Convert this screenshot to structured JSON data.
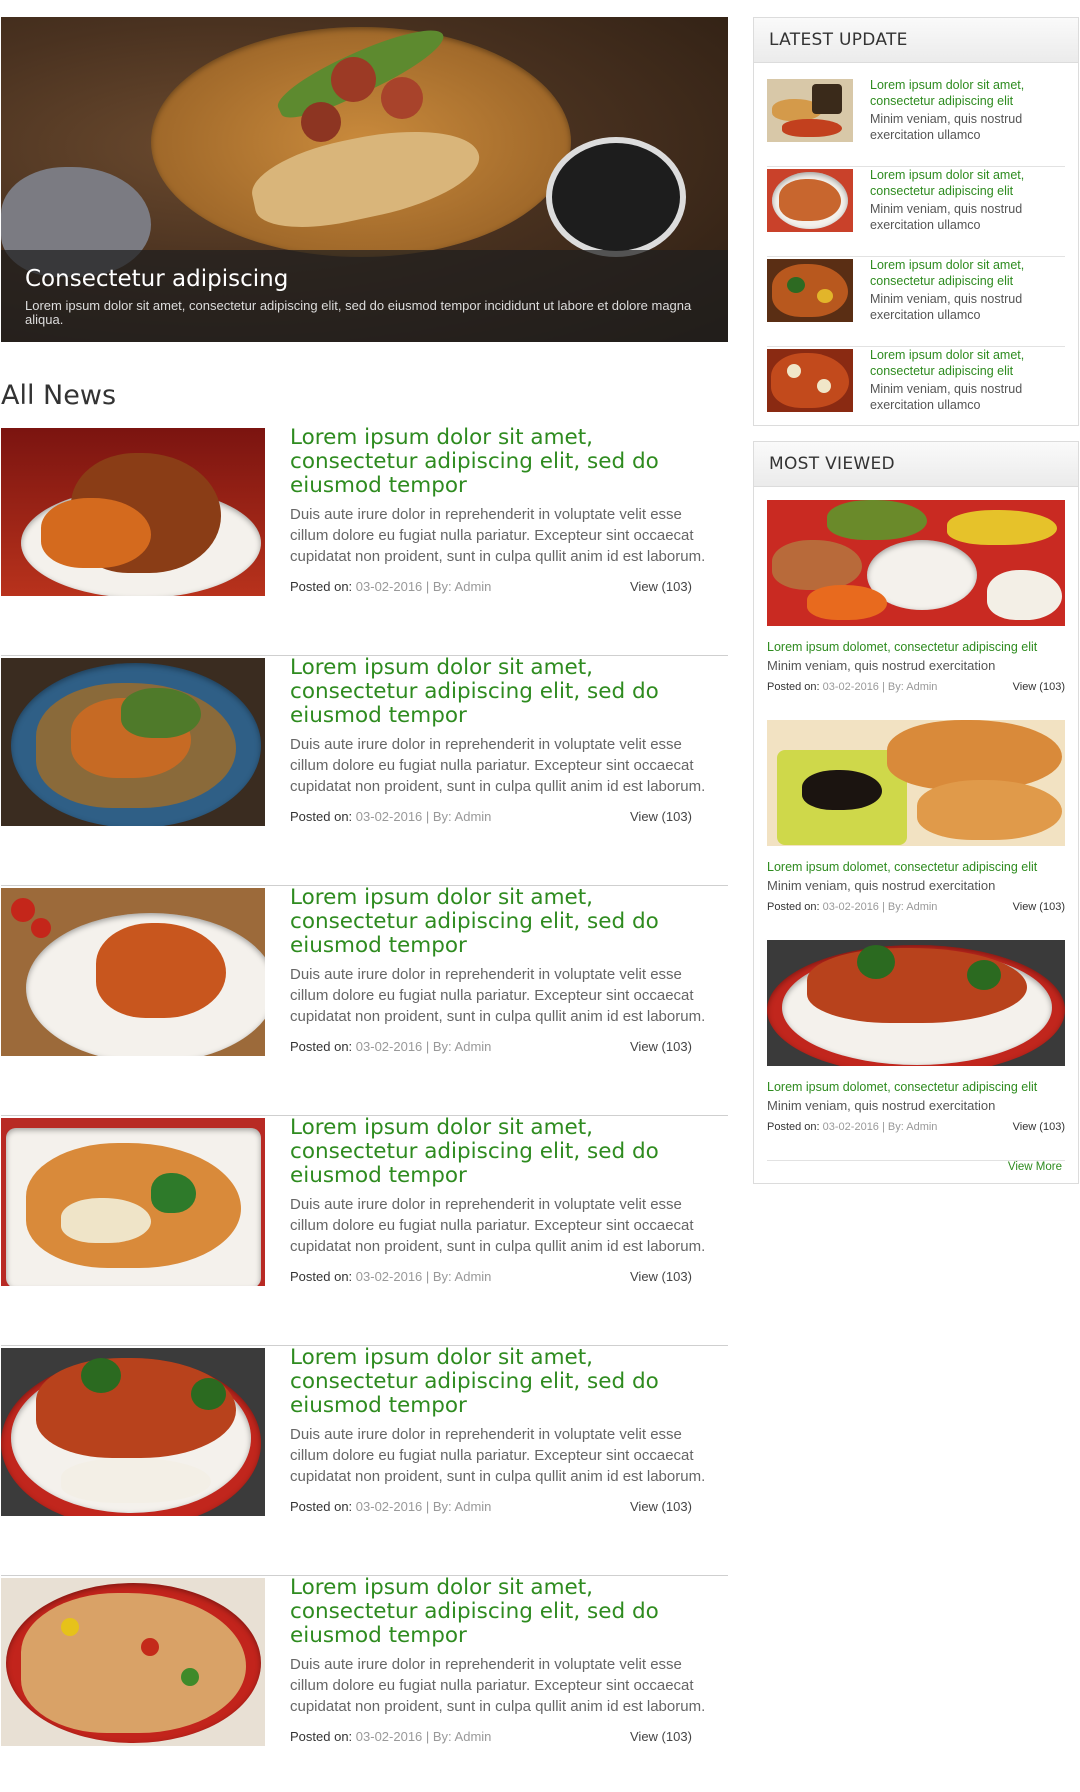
{
  "hero": {
    "title": "Consectetur adipiscing",
    "text": "Lorem ipsum dolor sit amet, consectetur adipiscing elit, sed do eiusmod tempor incididunt ut labore et dolore magna aliqua."
  },
  "news": {
    "heading": "All News",
    "posted_label": "Posted on:",
    "items": [
      {
        "title": "Lorem ipsum dolor sit amet, consectetur adipiscing elit, sed do eiusmod tempor",
        "text": "Duis aute irure dolor in reprehenderit in voluptate velit esse cillum dolore eu fugiat nulla pariatur. Excepteur sint occaecat cupidatat non proident, sunt in culpa qullit anim id est laborum.",
        "meta": "03-02-2016 | By: Admin",
        "views": "View (103)"
      },
      {
        "title": "Lorem ipsum dolor sit amet, consectetur adipiscing elit, sed do eiusmod tempor",
        "text": "Duis aute irure dolor in reprehenderit in voluptate velit esse cillum dolore eu fugiat nulla pariatur. Excepteur sint occaecat cupidatat non proident, sunt in culpa qullit anim id est laborum.",
        "meta": "03-02-2016 | By: Admin",
        "views": "View (103)"
      },
      {
        "title": "Lorem ipsum dolor sit amet, consectetur adipiscing elit, sed do eiusmod tempor",
        "text": "Duis aute irure dolor in reprehenderit in voluptate velit esse cillum dolore eu fugiat nulla pariatur. Excepteur sint occaecat cupidatat non proident, sunt in culpa qullit anim id est laborum.",
        "meta": "03-02-2016 | By: Admin",
        "views": "View (103)"
      },
      {
        "title": "Lorem ipsum dolor sit amet, consectetur adipiscing elit, sed do eiusmod tempor",
        "text": "Duis aute irure dolor in reprehenderit in voluptate velit esse cillum dolore eu fugiat nulla pariatur. Excepteur sint occaecat cupidatat non proident, sunt in culpa qullit anim id est laborum.",
        "meta": "03-02-2016 | By: Admin",
        "views": "View (103)"
      },
      {
        "title": "Lorem ipsum dolor sit amet, consectetur adipiscing elit, sed do eiusmod tempor",
        "text": "Duis aute irure dolor in reprehenderit in voluptate velit esse cillum dolore eu fugiat nulla pariatur. Excepteur sint occaecat cupidatat non proident, sunt in culpa qullit anim id est laborum.",
        "meta": "03-02-2016 | By: Admin",
        "views": "View (103)"
      },
      {
        "title": "Lorem ipsum dolor sit amet, consectetur adipiscing elit, sed do eiusmod tempor",
        "text": "Duis aute irure dolor in reprehenderit in voluptate velit esse cillum dolore eu fugiat nulla pariatur. Excepteur sint occaecat cupidatat non proident, sunt in culpa qullit anim id est laborum.",
        "meta": "03-02-2016 | By: Admin",
        "views": "View (103)"
      }
    ]
  },
  "latest": {
    "heading": "LATEST UPDATE",
    "items": [
      {
        "title": "Lorem ipsum dolor sit amet, consectetur adipiscing elit",
        "text": "Minim veniam, quis nostrud exercitation ullamco"
      },
      {
        "title": "Lorem ipsum dolor sit amet, consectetur adipiscing elit",
        "text": "Minim veniam, quis nostrud exercitation ullamco"
      },
      {
        "title": "Lorem ipsum dolor sit amet, consectetur adipiscing elit",
        "text": "Minim veniam, quis nostrud exercitation ullamco"
      },
      {
        "title": "Lorem ipsum dolor sit amet, consectetur adipiscing elit",
        "text": "Minim veniam, quis nostrud exercitation ullamco"
      }
    ]
  },
  "viewed": {
    "heading": "MOST VIEWED",
    "posted_label": "Posted on:",
    "more": "View More",
    "items": [
      {
        "title": "Lorem ipsum dolomet, consectetur adipiscing elit",
        "text": "Minim veniam, quis nostrud exercitation",
        "meta": "03-02-2016 | By: Admin",
        "views": "View (103)"
      },
      {
        "title": "Lorem ipsum dolomet, consectetur adipiscing elit",
        "text": "Minim veniam, quis nostrud exercitation",
        "meta": "03-02-2016 | By: Admin",
        "views": "View (103)"
      },
      {
        "title": "Lorem ipsum dolomet, consectetur adipiscing elit",
        "text": "Minim veniam, quis nostrud exercitation",
        "meta": "03-02-2016 | By: Admin",
        "views": "View (103)"
      }
    ]
  },
  "colors": {
    "accent": "#2e8b1f",
    "text": "#666666",
    "rule": "#cfcfcf"
  }
}
